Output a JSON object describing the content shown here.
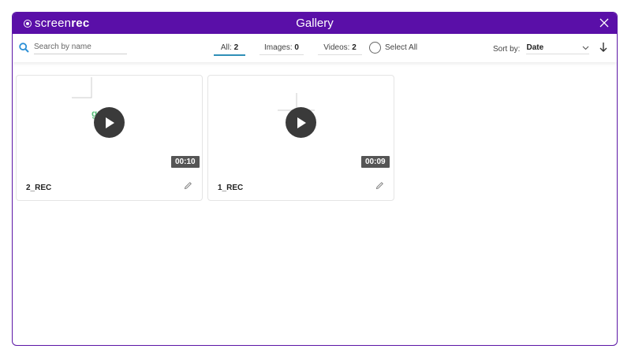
{
  "app": {
    "brand_light": "screen",
    "brand_bold": "rec",
    "title": "Gallery"
  },
  "toolbar": {
    "search_placeholder": "Search by name",
    "filters": [
      {
        "label": "All:",
        "count": "2",
        "active": true
      },
      {
        "label": "Images:",
        "count": "0",
        "active": false
      },
      {
        "label": "Videos:",
        "count": "2",
        "active": false
      }
    ],
    "select_all": "Select All",
    "sort_label": "Sort by:",
    "sort_value": "Date"
  },
  "items": [
    {
      "name": "2_REC",
      "duration": "00:10",
      "thumb_text": "green"
    },
    {
      "name": "1_REC",
      "duration": "00:09",
      "thumb_text": ""
    }
  ],
  "colors": {
    "titlebar": "#5a0fa8",
    "accent": "#2f8fb7",
    "search_icon": "#2b8fd6"
  }
}
